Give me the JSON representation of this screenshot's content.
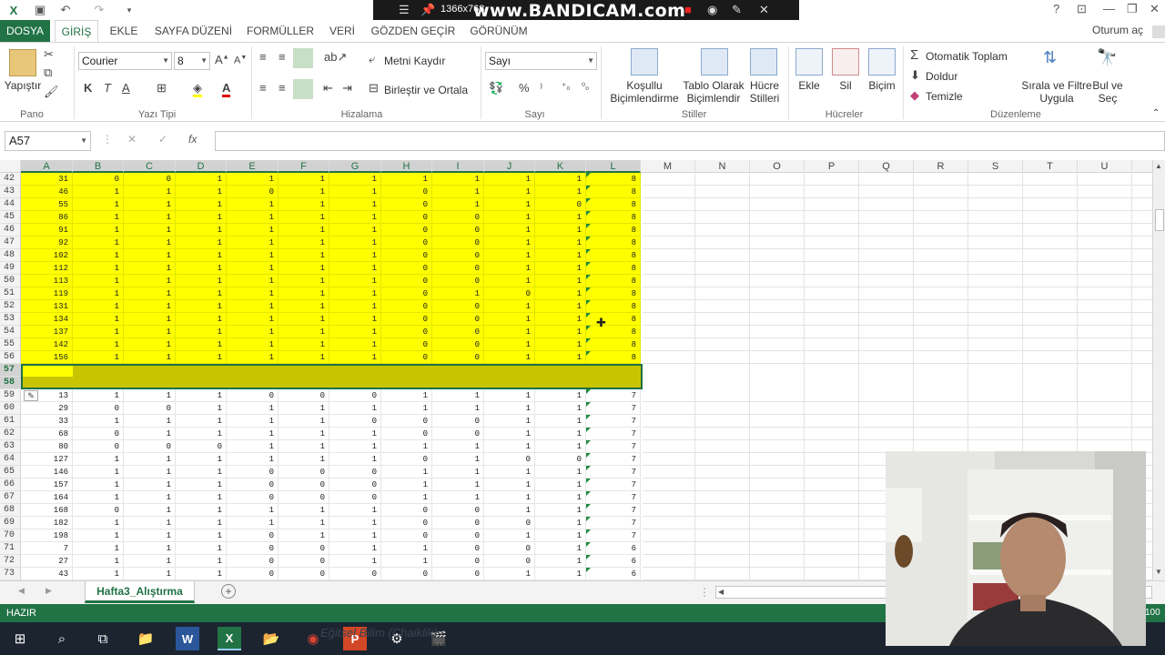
{
  "recorder": {
    "resolution": "1366x768",
    "brand": "www.BANDICAM.com"
  },
  "tabs": [
    {
      "label": "DOSYA"
    },
    {
      "label": "GİRİŞ"
    },
    {
      "label": "EKLE"
    },
    {
      "label": "SAYFA DÜZENİ"
    },
    {
      "label": "FORMÜLLER"
    },
    {
      "label": "VERİ"
    },
    {
      "label": "GÖZDEN GEÇİR"
    },
    {
      "label": "GÖRÜNÜM"
    }
  ],
  "user": "Oturum aç",
  "ribbon": {
    "paste": "Yapıştır",
    "font_name": "Courier",
    "font_size": "8",
    "wrap_text": "Metni Kaydır",
    "merge_center": "Birleştir ve Ortala",
    "number_format": "Sayı",
    "cond_format_1": "Koşullu",
    "cond_format_2": "Biçimlendirme",
    "table_format_1": "Tablo Olarak",
    "table_format_2": "Biçimlendir",
    "cell_styles_1": "Hücre",
    "cell_styles_2": "Stilleri",
    "insert": "Ekle",
    "delete": "Sil",
    "format": "Biçim",
    "autosum": "Otomatik Toplam",
    "fill": "Doldur",
    "clear": "Temizle",
    "sort_filter_1": "Sırala ve Filtre",
    "sort_filter_2": "Uygula",
    "find_select_1": "Bul ve",
    "find_select_2": "Seç",
    "groups": {
      "clipboard": "Pano",
      "font": "Yazı Tipi",
      "alignment": "Hizalama",
      "number": "Sayı",
      "styles": "Stiller",
      "cells": "Hücreler",
      "editing": "Düzenleme"
    }
  },
  "formula_bar": {
    "name_box": "A57",
    "fx": "fx",
    "value": ""
  },
  "columns": [
    "A",
    "B",
    "C",
    "D",
    "E",
    "F",
    "G",
    "H",
    "I",
    "J",
    "K",
    "L",
    "M",
    "N",
    "O",
    "P",
    "Q",
    "R",
    "S",
    "T",
    "U"
  ],
  "rows_yellow": [
    {
      "n": "42",
      "v": [
        "31",
        "0",
        "0",
        "1",
        "1",
        "1",
        "1",
        "1",
        "1",
        "1",
        "1",
        "8"
      ]
    },
    {
      "n": "43",
      "v": [
        "46",
        "1",
        "1",
        "1",
        "0",
        "1",
        "1",
        "0",
        "1",
        "1",
        "1",
        "8"
      ]
    },
    {
      "n": "44",
      "v": [
        "55",
        "1",
        "1",
        "1",
        "1",
        "1",
        "1",
        "0",
        "1",
        "1",
        "0",
        "8"
      ]
    },
    {
      "n": "45",
      "v": [
        "86",
        "1",
        "1",
        "1",
        "1",
        "1",
        "1",
        "0",
        "0",
        "1",
        "1",
        "8"
      ]
    },
    {
      "n": "46",
      "v": [
        "91",
        "1",
        "1",
        "1",
        "1",
        "1",
        "1",
        "0",
        "0",
        "1",
        "1",
        "8"
      ]
    },
    {
      "n": "47",
      "v": [
        "92",
        "1",
        "1",
        "1",
        "1",
        "1",
        "1",
        "0",
        "0",
        "1",
        "1",
        "8"
      ]
    },
    {
      "n": "48",
      "v": [
        "102",
        "1",
        "1",
        "1",
        "1",
        "1",
        "1",
        "0",
        "0",
        "1",
        "1",
        "8"
      ]
    },
    {
      "n": "49",
      "v": [
        "112",
        "1",
        "1",
        "1",
        "1",
        "1",
        "1",
        "0",
        "0",
        "1",
        "1",
        "8"
      ]
    },
    {
      "n": "50",
      "v": [
        "113",
        "1",
        "1",
        "1",
        "1",
        "1",
        "1",
        "0",
        "0",
        "1",
        "1",
        "8"
      ]
    },
    {
      "n": "51",
      "v": [
        "119",
        "1",
        "1",
        "1",
        "1",
        "1",
        "1",
        "0",
        "1",
        "0",
        "1",
        "8"
      ]
    },
    {
      "n": "52",
      "v": [
        "131",
        "1",
        "1",
        "1",
        "1",
        "1",
        "1",
        "0",
        "0",
        "1",
        "1",
        "8"
      ]
    },
    {
      "n": "53",
      "v": [
        "134",
        "1",
        "1",
        "1",
        "1",
        "1",
        "1",
        "0",
        "0",
        "1",
        "1",
        "8"
      ]
    },
    {
      "n": "54",
      "v": [
        "137",
        "1",
        "1",
        "1",
        "1",
        "1",
        "1",
        "0",
        "0",
        "1",
        "1",
        "8"
      ]
    },
    {
      "n": "55",
      "v": [
        "142",
        "1",
        "1",
        "1",
        "1",
        "1",
        "1",
        "0",
        "0",
        "1",
        "1",
        "8"
      ]
    },
    {
      "n": "56",
      "v": [
        "156",
        "1",
        "1",
        "1",
        "1",
        "1",
        "1",
        "0",
        "0",
        "1",
        "1",
        "8"
      ]
    }
  ],
  "selected_rows": [
    "57",
    "58"
  ],
  "rows_white": [
    {
      "n": "59",
      "v": [
        "13",
        "1",
        "1",
        "1",
        "0",
        "0",
        "0",
        "1",
        "1",
        "1",
        "1",
        "7"
      ]
    },
    {
      "n": "60",
      "v": [
        "29",
        "0",
        "0",
        "1",
        "1",
        "1",
        "1",
        "1",
        "1",
        "1",
        "1",
        "7"
      ]
    },
    {
      "n": "61",
      "v": [
        "33",
        "1",
        "1",
        "1",
        "1",
        "1",
        "0",
        "0",
        "0",
        "1",
        "1",
        "7"
      ]
    },
    {
      "n": "62",
      "v": [
        "68",
        "0",
        "1",
        "1",
        "1",
        "1",
        "1",
        "0",
        "0",
        "1",
        "1",
        "7"
      ]
    },
    {
      "n": "63",
      "v": [
        "80",
        "0",
        "0",
        "0",
        "1",
        "1",
        "1",
        "1",
        "1",
        "1",
        "1",
        "7"
      ]
    },
    {
      "n": "64",
      "v": [
        "127",
        "1",
        "1",
        "1",
        "1",
        "1",
        "1",
        "0",
        "1",
        "0",
        "0",
        "7"
      ]
    },
    {
      "n": "65",
      "v": [
        "146",
        "1",
        "1",
        "1",
        "0",
        "0",
        "0",
        "1",
        "1",
        "1",
        "1",
        "7"
      ]
    },
    {
      "n": "66",
      "v": [
        "157",
        "1",
        "1",
        "1",
        "0",
        "0",
        "0",
        "1",
        "1",
        "1",
        "1",
        "7"
      ]
    },
    {
      "n": "67",
      "v": [
        "164",
        "1",
        "1",
        "1",
        "0",
        "0",
        "0",
        "1",
        "1",
        "1",
        "1",
        "7"
      ]
    },
    {
      "n": "68",
      "v": [
        "168",
        "0",
        "1",
        "1",
        "1",
        "1",
        "1",
        "0",
        "0",
        "1",
        "1",
        "7"
      ]
    },
    {
      "n": "69",
      "v": [
        "182",
        "1",
        "1",
        "1",
        "1",
        "1",
        "1",
        "0",
        "0",
        "0",
        "1",
        "7"
      ]
    },
    {
      "n": "70",
      "v": [
        "198",
        "1",
        "1",
        "1",
        "0",
        "1",
        "1",
        "0",
        "0",
        "1",
        "1",
        "7"
      ]
    },
    {
      "n": "71",
      "v": [
        "7",
        "1",
        "1",
        "1",
        "0",
        "0",
        "1",
        "1",
        "0",
        "0",
        "1",
        "6"
      ]
    },
    {
      "n": "72",
      "v": [
        "27",
        "1",
        "1",
        "1",
        "0",
        "0",
        "1",
        "1",
        "0",
        "0",
        "1",
        "6"
      ]
    },
    {
      "n": "73",
      "v": [
        "43",
        "1",
        "1",
        "1",
        "0",
        "0",
        "0",
        "0",
        "0",
        "1",
        "1",
        "6"
      ]
    }
  ],
  "sheet_tab": "Hafta3_Alıştırma",
  "status": "HAZIR",
  "zoom": "100",
  "taskbar_overlay_text": "Eğitsel Bilim (Chaiklik)"
}
